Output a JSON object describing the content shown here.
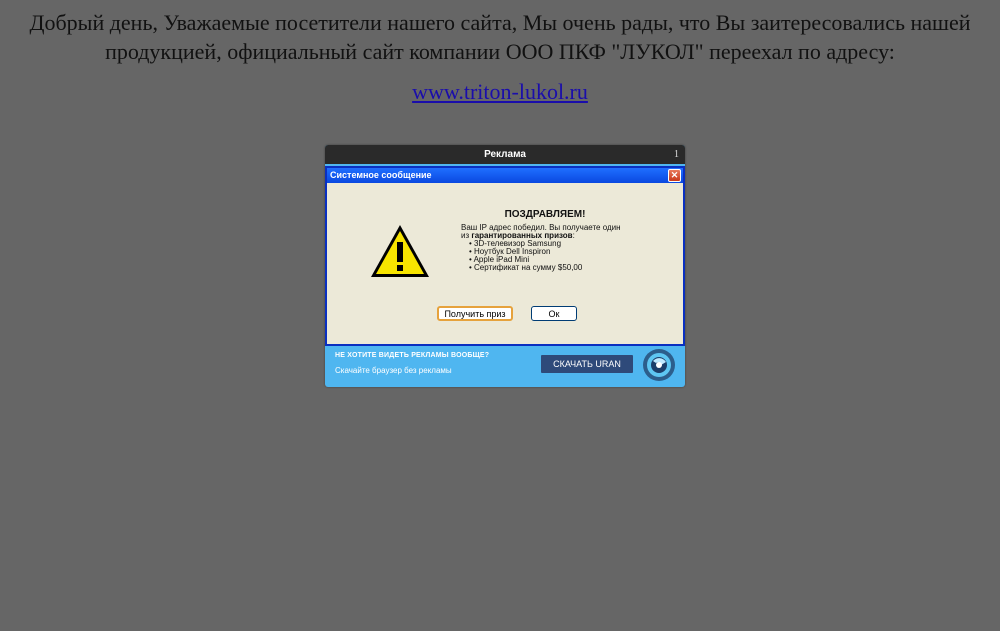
{
  "notice": {
    "line1": "Добрый день, Уважаемые посетители нашего сайта, Мы очень рады, что Вы заитересовались нашей",
    "line2": "продукцией, официальный сайт компании ООО ПКФ \"ЛУКОЛ\" переехал по адресу:",
    "link_text": "www.triton-lukol.ru"
  },
  "ad": {
    "title": "Реклама",
    "close_label": "1",
    "dialog": {
      "title": "Системное сообщение",
      "close_label": "✕",
      "heading": "ПОЗДРАВЛЯЕМ!",
      "line1": "Ваш IP адрес победил. Вы получаете один",
      "line2_prefix": "из ",
      "line2_bold": "гарантированных призов",
      "line2_suffix": ":",
      "prizes": [
        "3D-телевизор Samsung",
        "Ноутбук Dell Inspiron",
        "Apple iPad Mini",
        "Сертификат на сумму $50,00"
      ],
      "prize_button": "Получить приз",
      "ok_button": "Ок"
    },
    "promo": {
      "question": "НЕ ХОТИТЕ ВИДЕТЬ РЕКЛАМЫ ВООБЩЕ?",
      "subtitle": "Скачайте браузер без рекламы",
      "button": "СКАЧАТЬ URAN"
    }
  },
  "icons": {
    "warning": "warning-icon",
    "browser_logo": "uran-logo-icon"
  },
  "colors": {
    "page_bg": "#666666",
    "ad_blue": "#4fb6f0",
    "dialog_border": "#0a2fc0",
    "dialog_bg": "#ece9d8",
    "link": "#1a0dab"
  }
}
